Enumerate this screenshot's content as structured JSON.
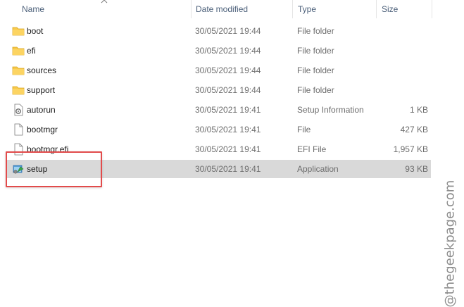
{
  "columns": {
    "name": "Name",
    "date_modified": "Date modified",
    "type": "Type",
    "size": "Size"
  },
  "files": [
    {
      "name": "boot",
      "date": "30/05/2021 19:44",
      "type": "File folder",
      "size": "",
      "icon": "folder-icon"
    },
    {
      "name": "efi",
      "date": "30/05/2021 19:44",
      "type": "File folder",
      "size": "",
      "icon": "folder-icon"
    },
    {
      "name": "sources",
      "date": "30/05/2021 19:44",
      "type": "File folder",
      "size": "",
      "icon": "folder-icon"
    },
    {
      "name": "support",
      "date": "30/05/2021 19:44",
      "type": "File folder",
      "size": "",
      "icon": "folder-icon"
    },
    {
      "name": "autorun",
      "date": "30/05/2021 19:41",
      "type": "Setup Information",
      "size": "1 KB",
      "icon": "setup-info-file-icon"
    },
    {
      "name": "bootmgr",
      "date": "30/05/2021 19:41",
      "type": "File",
      "size": "427 KB",
      "icon": "file-icon"
    },
    {
      "name": "bootmgr.efi",
      "date": "30/05/2021 19:41",
      "type": "EFI File",
      "size": "1,957 KB",
      "icon": "file-icon"
    },
    {
      "name": "setup",
      "date": "30/05/2021 19:41",
      "type": "Application",
      "size": "93 KB",
      "icon": "application-icon",
      "selected": true
    }
  ],
  "watermark": "@thegeekpage.com",
  "colors": {
    "selection": "#d9d9d9",
    "highlight_box": "#e24b4b",
    "folder": "#f8c94a",
    "header_text": "#4c607a"
  }
}
